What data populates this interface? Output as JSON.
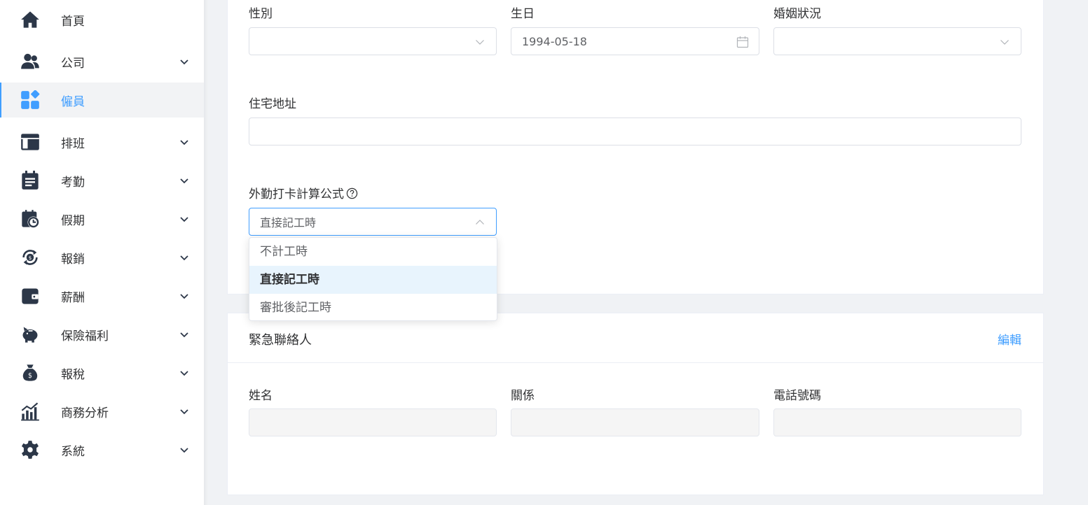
{
  "sidebar": {
    "items": [
      {
        "label": "首頁",
        "icon": "home-icon",
        "has_chevron": false,
        "active": false
      },
      {
        "label": "公司",
        "icon": "users-icon",
        "has_chevron": true,
        "active": false
      },
      {
        "label": "僱員",
        "icon": "grid-icon",
        "has_chevron": false,
        "active": true
      },
      {
        "label": "排班",
        "icon": "layout-icon",
        "has_chevron": true,
        "active": false
      },
      {
        "label": "考勤",
        "icon": "calendar-icon",
        "has_chevron": true,
        "active": false
      },
      {
        "label": "假期",
        "icon": "calendar-clock-icon",
        "has_chevron": true,
        "active": false
      },
      {
        "label": "報銷",
        "icon": "money-refresh-icon",
        "has_chevron": true,
        "active": false
      },
      {
        "label": "薪酬",
        "icon": "wallet-icon",
        "has_chevron": true,
        "active": false
      },
      {
        "label": "保險福利",
        "icon": "piggy-bank-icon",
        "has_chevron": true,
        "active": false
      },
      {
        "label": "報稅",
        "icon": "money-bag-icon",
        "has_chevron": true,
        "active": false
      },
      {
        "label": "商務分析",
        "icon": "bar-chart-icon",
        "has_chevron": true,
        "active": false
      },
      {
        "label": "系統",
        "icon": "gear-icon",
        "has_chevron": true,
        "active": false
      }
    ]
  },
  "personal": {
    "gender_label": "性別",
    "gender_value": "",
    "birthday_label": "生日",
    "birthday_value": "1994-05-18",
    "marital_label": "婚姻狀況",
    "marital_value": "",
    "address_label": "住宅地址",
    "address_value": "",
    "formula_label": "外勤打卡計算公式",
    "formula_value": "直接記工時",
    "formula_options": [
      "不計工時",
      "直接記工時",
      "審批後記工時"
    ],
    "formula_selected_index": 1
  },
  "emergency": {
    "title": "緊急聯絡人",
    "edit_label": "編輯",
    "name_label": "姓名",
    "relation_label": "關係",
    "phone_label": "電話號碼"
  },
  "colors": {
    "accent": "#409eff",
    "nav_icon": "#2c3748"
  }
}
